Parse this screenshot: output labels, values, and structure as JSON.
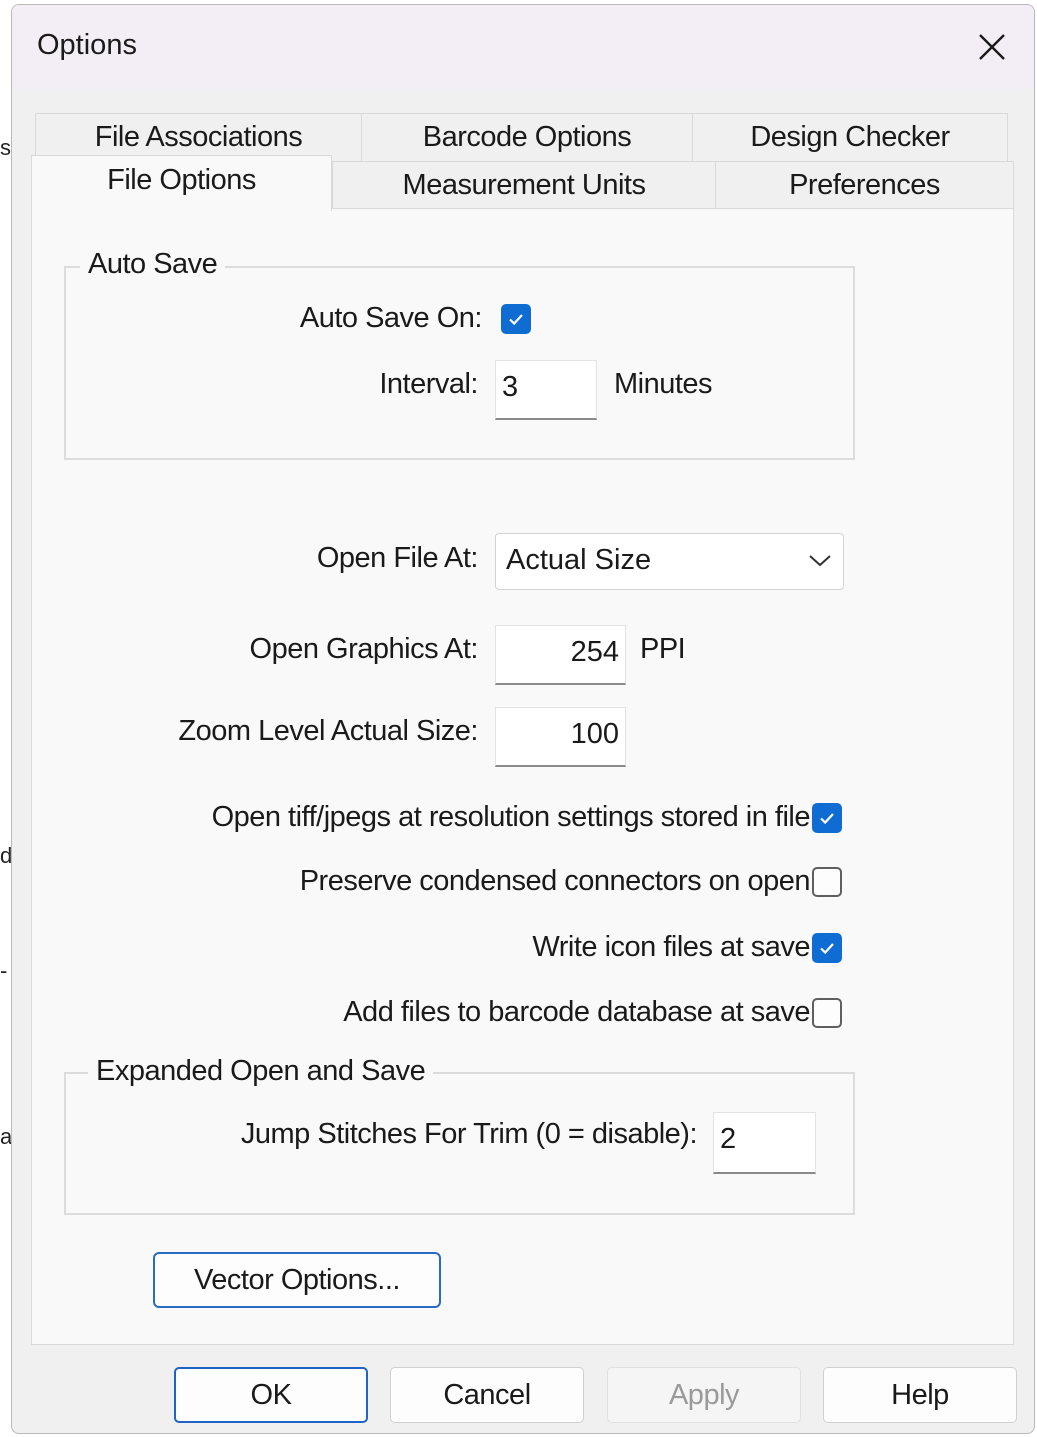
{
  "background": {
    "fragments": [
      "s",
      "d",
      "-",
      "a"
    ]
  },
  "window": {
    "title": "Options"
  },
  "tabs": {
    "row_back": [
      "File Associations",
      "Barcode Options",
      "Design Checker"
    ],
    "row_front": [
      "File Options",
      "Measurement Units",
      "Preferences"
    ],
    "active": "File Options"
  },
  "auto_save": {
    "legend": "Auto Save",
    "auto_save_on_label": "Auto Save On:",
    "auto_save_on": true,
    "interval_label": "Interval:",
    "interval_value": "3",
    "interval_unit": "Minutes"
  },
  "open_file_at": {
    "label": "Open File At:",
    "value": "Actual Size"
  },
  "open_graphics_at": {
    "label": "Open Graphics At:",
    "value": "254",
    "unit": "PPI"
  },
  "zoom_level": {
    "label": "Zoom Level Actual Size:",
    "value": "100"
  },
  "options": [
    {
      "label": "Open tiff/jpegs at resolution settings stored in file",
      "checked": true
    },
    {
      "label": "Preserve condensed connectors on open",
      "checked": false
    },
    {
      "label": "Write icon files at save",
      "checked": true
    },
    {
      "label": "Add files to barcode database at save",
      "checked": false
    }
  ],
  "expanded": {
    "legend": "Expanded Open and Save",
    "jump_label": "Jump Stitches For Trim (0 = disable):",
    "jump_value": "2"
  },
  "vector_button": "Vector Options...",
  "buttons": {
    "ok": "OK",
    "cancel": "Cancel",
    "apply": "Apply",
    "help": "Help"
  },
  "colors": {
    "accent": "#0f6cd3",
    "title_bar": "#f3eef5",
    "panel": "#f9f9f9"
  }
}
